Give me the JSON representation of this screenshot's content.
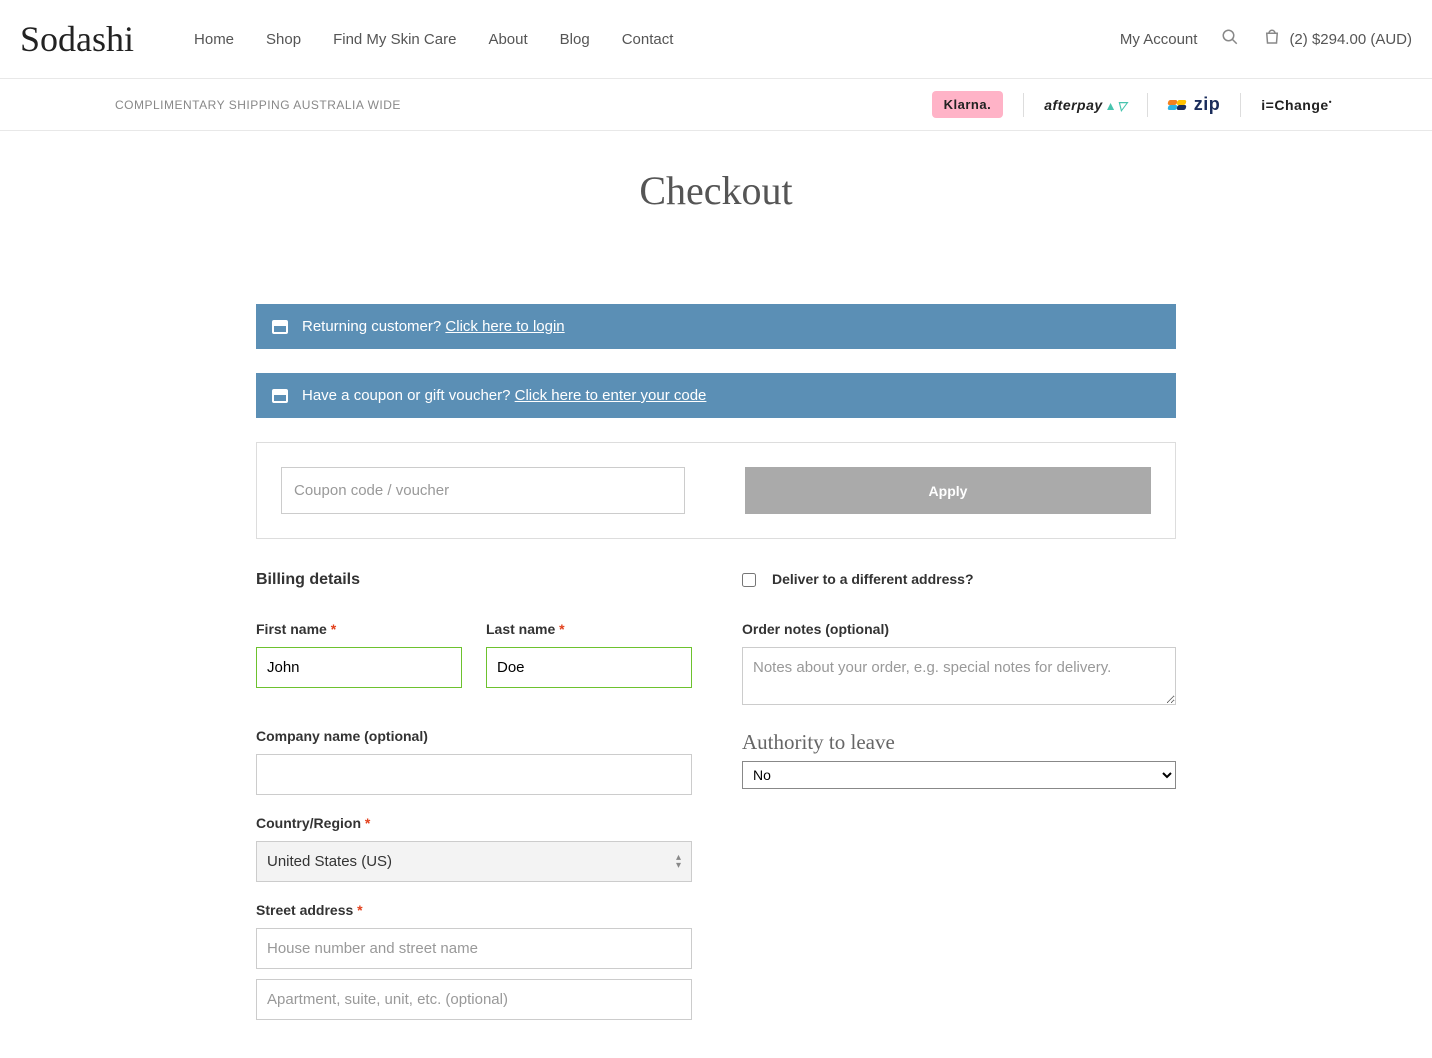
{
  "header": {
    "logo_text": "Sodashi",
    "nav": [
      "Home",
      "Shop",
      "Find My Skin Care",
      "About",
      "Blog",
      "Contact"
    ],
    "my_account": "My Account",
    "cart_text": "(2) $294.00 (AUD)"
  },
  "subbar": {
    "shipping_text": "COMPLIMENTARY SHIPPING AUSTRALIA WIDE",
    "klarna": "Klarna.",
    "afterpay": "afterpay",
    "zip": "zip",
    "ichange": "i=Change"
  },
  "page": {
    "title": "Checkout"
  },
  "notices": {
    "returning_prompt": "Returning customer? ",
    "returning_link": "Click here to login",
    "coupon_prompt": "Have a coupon or gift voucher? ",
    "coupon_link": "Click here to enter your code"
  },
  "coupon": {
    "placeholder": "Coupon code / voucher",
    "button": "Apply"
  },
  "billing": {
    "heading": "Billing details",
    "first_name_label": "First name ",
    "first_name_value": "John",
    "last_name_label": "Last name ",
    "last_name_value": "Doe",
    "company_label": "Company name (optional)",
    "company_value": "",
    "country_label": "Country/Region ",
    "country_value": "United States (US)",
    "street_label": "Street address ",
    "street1_placeholder": "House number and street name",
    "street2_placeholder": "Apartment, suite, unit, etc. (optional)"
  },
  "shipping": {
    "deliver_label": "Deliver to a different address?",
    "notes_label": "Order notes (optional)",
    "notes_placeholder": "Notes about your order, e.g. special notes for delivery.",
    "atl_heading": "Authority to leave",
    "atl_value": "No"
  }
}
